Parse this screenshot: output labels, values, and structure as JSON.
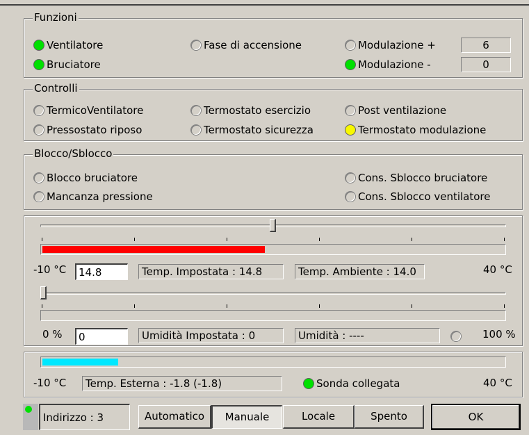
{
  "funzioni": {
    "title": "Funzioni",
    "ventilatore": "Ventilatore",
    "bruciatore": "Bruciatore",
    "fase_accensione": "Fase di accensione",
    "modulazione_piu": "Modulazione +",
    "modulazione_meno": "Modulazione -",
    "modulazione_piu_value": "6",
    "modulazione_meno_value": "0"
  },
  "controlli": {
    "title": "Controlli",
    "termico_ventilatore": "TermicoVentilatore",
    "pressostato_riposo": "Pressostato riposo",
    "termostato_esercizio": "Termostato esercizio",
    "termostato_sicurezza": "Termostato sicurezza",
    "post_ventilazione": "Post ventilazione",
    "termostato_modulazione": "Termostato modulazione"
  },
  "blocco": {
    "title": "Blocco/Sblocco",
    "blocco_bruciatore": "Blocco bruciatore",
    "mancanza_pressione": "Mancanza pressione",
    "cons_sblocco_bruciatore": "Cons. Sblocco bruciatore",
    "cons_sblocco_ventilatore": "Cons. Sblocco ventilatore"
  },
  "temperatura": {
    "min_label": "-10 °C",
    "max_label": "40 °C",
    "input_value": "14.8",
    "impostata": "Temp. Impostata : 14.8",
    "ambiente": "Temp. Ambiente : 14.0",
    "slider_value": 14.8,
    "fill_value": 14.0
  },
  "umidita": {
    "min_label": "0 %",
    "max_label": "100 %",
    "input_value": "0",
    "impostata": "Umidità Impostata :  0",
    "umidita": "Umidità : ----",
    "slider_value": 0
  },
  "esterna": {
    "min_label": "-10 °C",
    "max_label": "40 °C",
    "temp_esterna": "Temp. Esterna : -1.8 (-1.8)",
    "sonda": "Sonda collegata",
    "fill_value": -1.8
  },
  "bottom": {
    "indirizzo": "Indirizzo : 3",
    "automatico": "Automatico",
    "manuale": "Manuale",
    "locale": "Locale",
    "spento": "Spento",
    "ok": "OK"
  },
  "colors": {
    "led_on": "#00e000",
    "led_warn": "#f8f800",
    "temp_bar": "#ff0000",
    "ext_bar": "#00e8ff"
  }
}
